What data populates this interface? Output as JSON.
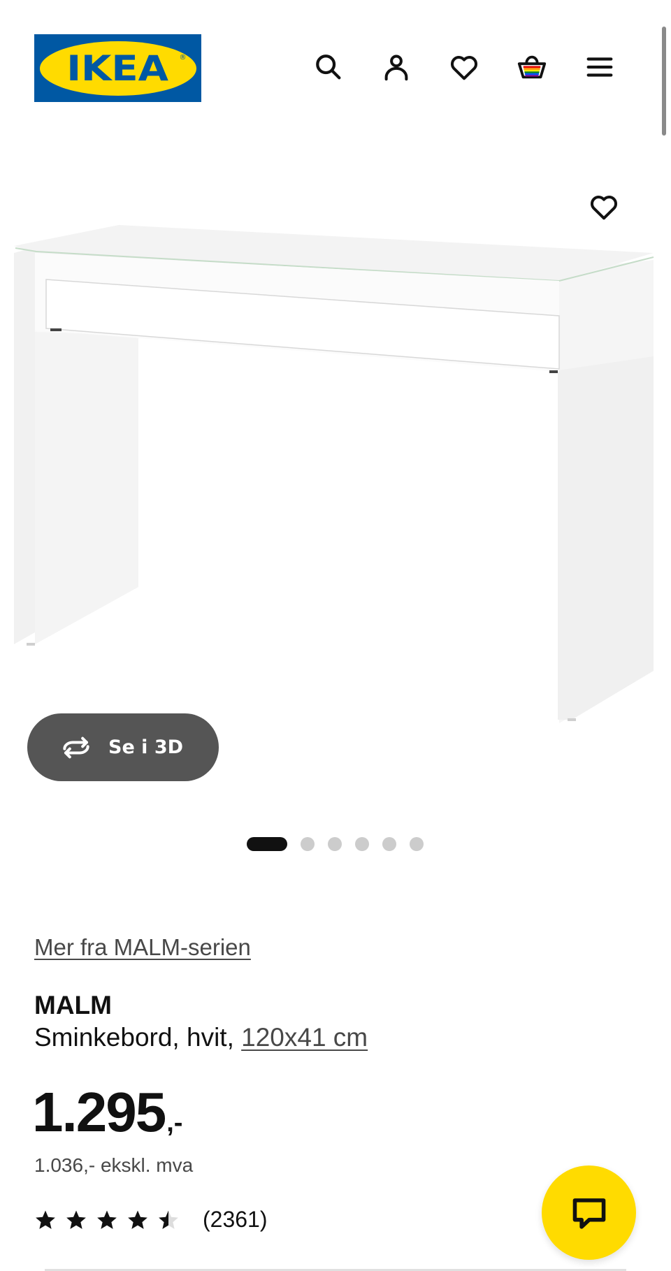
{
  "header": {
    "logo_text": "IKEA",
    "logo_registered": "®",
    "icons": [
      "search-icon",
      "account-icon",
      "favourites-icon",
      "shopping-basket-icon",
      "menu-icon"
    ]
  },
  "gallery": {
    "favourite_icon": "heart-icon",
    "see_3d_label": "Se i 3D",
    "dots_total": 6,
    "active_dot": 1
  },
  "product": {
    "series_link": "Mer fra MALM-serien",
    "name": "MALM",
    "description": "Sminkebord, hvit, ",
    "size_link": "120x41 cm",
    "price_main": "1.295",
    "price_suffix": ",-",
    "price_excl_vat": "1.036,- ekskl. mva",
    "rating": 4.5,
    "rating_max": 5,
    "review_count": "(2361)"
  },
  "chat": {
    "icon": "chat-icon"
  },
  "colors": {
    "brand_blue": "#0058a3",
    "brand_yellow": "#ffdb00",
    "text": "#111111",
    "muted_text": "#484848",
    "pill_bg": "#555555"
  }
}
